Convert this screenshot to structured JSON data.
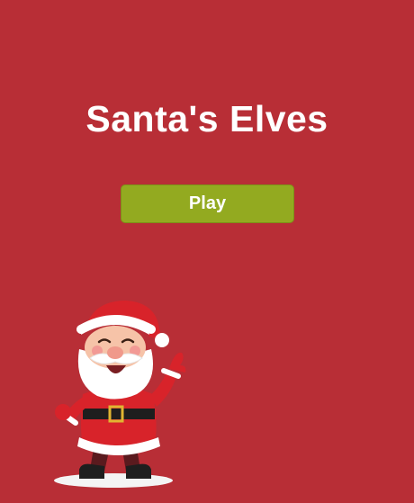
{
  "game": {
    "title": "Santa's Elves",
    "play_label": "Play"
  },
  "mascot": {
    "icon": "santa-claus-icon"
  },
  "colors": {
    "background": "#b82e36",
    "button": "#93aa20",
    "text": "#ffffff"
  }
}
